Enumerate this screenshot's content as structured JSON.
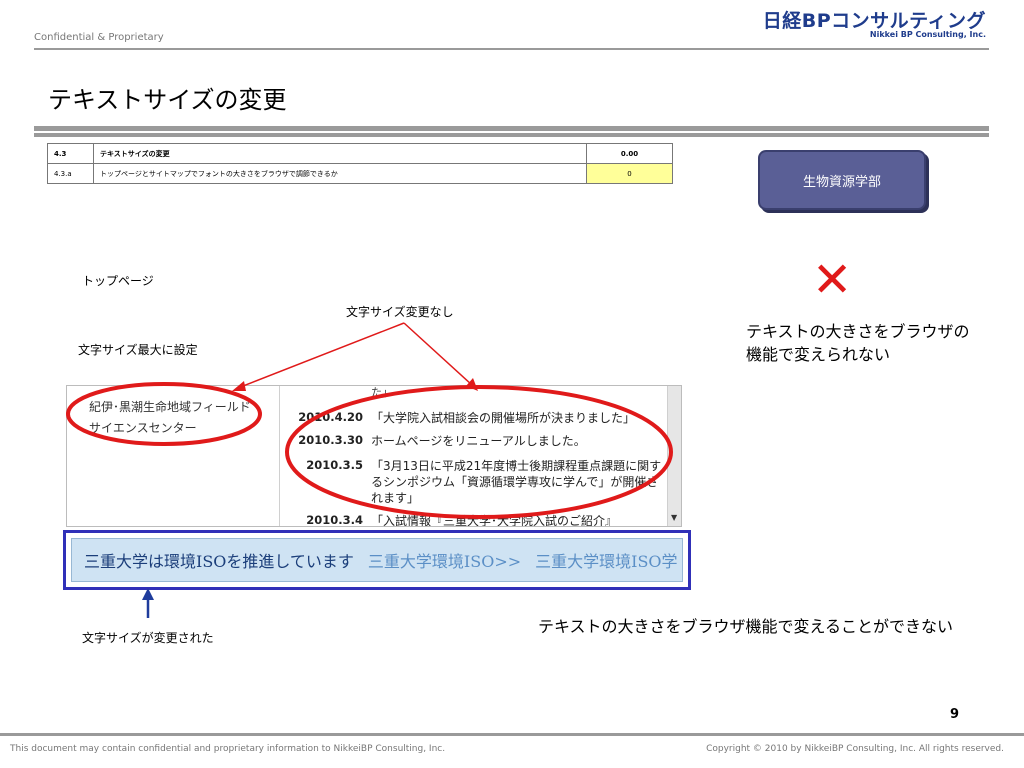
{
  "header": {
    "confidential": "Confidential & Proprietary",
    "brand_jp": "日経BPコンサルティング",
    "brand_en": "Nikkei BP Consulting, Inc."
  },
  "page_title": "テキストサイズの変更",
  "criteria_table": [
    {
      "num": "4.3",
      "text": "テキストサイズの変更",
      "value": "0.00"
    },
    {
      "num": "4.3.a",
      "text": "トップページとサイトマップでフォントの大きさをブラウザで調節できるか",
      "value": "0"
    }
  ],
  "faculty_button": "生物資源学部",
  "labels": {
    "top_page": "トップページ",
    "no_change": "文字サイズ変更なし",
    "max_setting": "文字サイズ最大に設定",
    "changed": "文字サイズが変更された"
  },
  "verdict": {
    "mark": "✕",
    "top": "テキストの大きさをブラウザの機能で変えられない",
    "bottom": "テキストの大きさをブラウザ機能で変えることができない"
  },
  "screenshot": {
    "sidebar_text": "紀伊･黒潮生命地域フィールドサイエンスセンター",
    "top_cut": "た」",
    "news": [
      {
        "date": "2010.4.20",
        "text": "「大学院入試相談会の開催場所が決まりました」"
      },
      {
        "date": "2010.3.30",
        "text": "ホームページをリニューアルしました。"
      },
      {
        "date": "2010.3.5",
        "text": "「3月13日に平成21年度博士後期課程重点課題に関するシンポジウム「資源循環学専攻に学んで」が開催されます」"
      },
      {
        "date": "2010.3.4",
        "text": "「入試情報『三重大学･大学院入試のご紹介』"
      }
    ]
  },
  "banner": {
    "item1": "三重大学は環境ISOを推進しています",
    "item2": "三重大学環境ISO>>",
    "item3": "三重大学環境ISO学"
  },
  "footer": {
    "page_number": "9",
    "left": "This document may contain confidential and proprietary information to NikkeiBP Consulting, Inc.",
    "right": "Copyright © 2010 by NikkeiBP Consulting, Inc. All rights reserved."
  },
  "colors": {
    "brand": "#1f3c8c",
    "highlight_yellow": "#ffff99",
    "button_fill": "#5a5f96",
    "annotation_red": "#e01a1a",
    "banner_border": "#3030b8",
    "banner_fill": "#cfe3f3"
  }
}
